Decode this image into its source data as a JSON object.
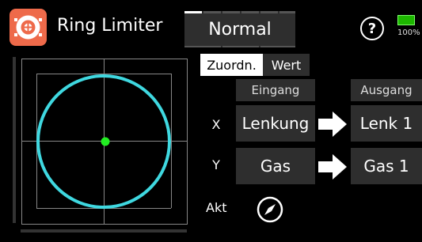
{
  "header": {
    "app_icon": "ring-limiter-icon",
    "title": "Ring Limiter",
    "mode": "Normal",
    "help_icon": "help-icon",
    "battery_icon": "battery-icon",
    "battery_percent": "100%"
  },
  "tabs": [
    {
      "label": "Zuordn.",
      "active": true
    },
    {
      "label": "Wert",
      "active": false
    }
  ],
  "columns": {
    "input": "Eingang",
    "output": "Ausgang"
  },
  "rows": [
    {
      "label": "X",
      "input": "Lenkung",
      "output": "Lenk 1"
    },
    {
      "label": "Y",
      "input": "Gas",
      "output": "Gas 1"
    }
  ],
  "akt": {
    "label": "Akt",
    "icon": "compass-icon"
  },
  "graph": {
    "circle_color": "#3fd8e0",
    "point_color": "#22ee22",
    "accent_color": "#ee6a4a",
    "battery_color": "#1db700"
  }
}
